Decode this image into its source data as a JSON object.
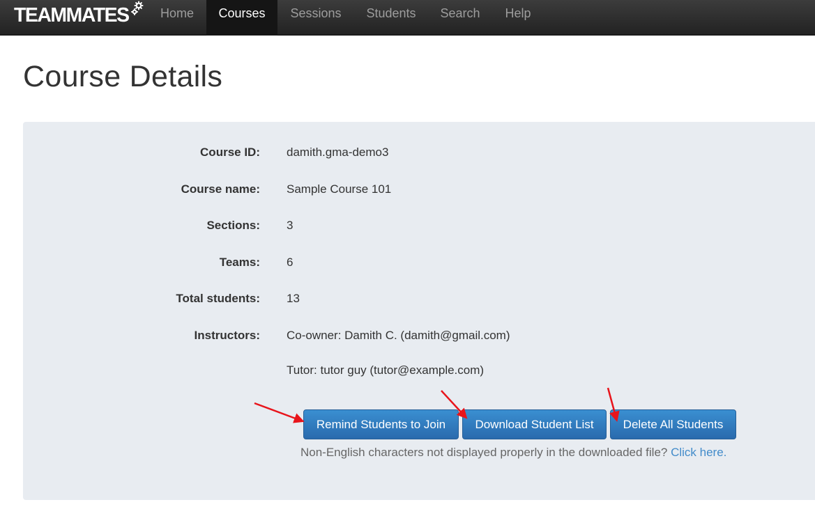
{
  "nav": {
    "brand": "TEAMMATES",
    "items": [
      {
        "label": "Home",
        "active": false
      },
      {
        "label": "Courses",
        "active": true
      },
      {
        "label": "Sessions",
        "active": false
      },
      {
        "label": "Students",
        "active": false
      },
      {
        "label": "Search",
        "active": false
      },
      {
        "label": "Help",
        "active": false
      }
    ]
  },
  "page": {
    "title": "Course Details"
  },
  "details": [
    {
      "label": "Course ID:",
      "value": "damith.gma-demo3"
    },
    {
      "label": "Course name:",
      "value": "Sample Course 101"
    },
    {
      "label": "Sections:",
      "value": "3"
    },
    {
      "label": "Teams:",
      "value": "6"
    },
    {
      "label": "Total students:",
      "value": "13"
    },
    {
      "label": "Instructors:",
      "values": [
        "Co-owner: Damith C. (damith@gmail.com)",
        "Tutor: tutor guy (tutor@example.com)"
      ]
    }
  ],
  "actions": {
    "remind_label": "Remind Students to Join",
    "download_label": "Download Student List",
    "delete_label": "Delete All Students"
  },
  "help": {
    "text": "Non-English characters not displayed properly in the downloaded file? ",
    "link": "Click here."
  },
  "colors": {
    "navbar": "#222222",
    "panel": "#e8ecf1",
    "button": "#337ab7",
    "link": "#428bca",
    "annotation_arrow": "#e8141b"
  },
  "icons": {
    "brand_gears": "gears-icon",
    "annotation": "red-arrow-icon"
  }
}
